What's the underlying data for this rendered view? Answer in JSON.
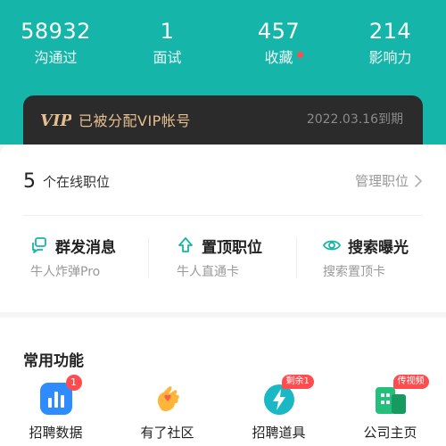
{
  "stats": [
    {
      "value": "58932",
      "label": "沟通过"
    },
    {
      "value": "1",
      "label": "面试"
    },
    {
      "value": "457",
      "label": "收藏"
    },
    {
      "value": "214",
      "label": "影响力"
    }
  ],
  "vip": {
    "logo": "VIP",
    "text": "已被分配VIP帐号",
    "expiry": "2022.03.16到期"
  },
  "positions": {
    "count": "5",
    "label": "个在线职位",
    "manage": "管理职位"
  },
  "actions": [
    {
      "title": "群发消息",
      "sub": "牛人炸弹Pro",
      "icon": "message-icon"
    },
    {
      "title": "置顶职位",
      "sub": "牛人直通卡",
      "icon": "pin-top-icon"
    },
    {
      "title": "搜索曝光",
      "sub": "搜索置顶卡",
      "icon": "eye-icon"
    }
  ],
  "functions": {
    "title": "常用功能",
    "items": [
      {
        "label": "招聘数据",
        "badge": "1",
        "icon": "chart-icon"
      },
      {
        "label": "有了社区",
        "badge": "",
        "icon": "hand-heart-icon"
      },
      {
        "label": "招聘道具",
        "badge": "剩余1",
        "icon": "lightning-icon"
      },
      {
        "label": "公司主页",
        "badge": "传视频",
        "icon": "company-icon"
      }
    ]
  },
  "colors": {
    "header": "#15b5a9",
    "accent": "#15b5a9",
    "vip_gold": "#e6bf8f",
    "badge_red": "#ff4d4f"
  }
}
